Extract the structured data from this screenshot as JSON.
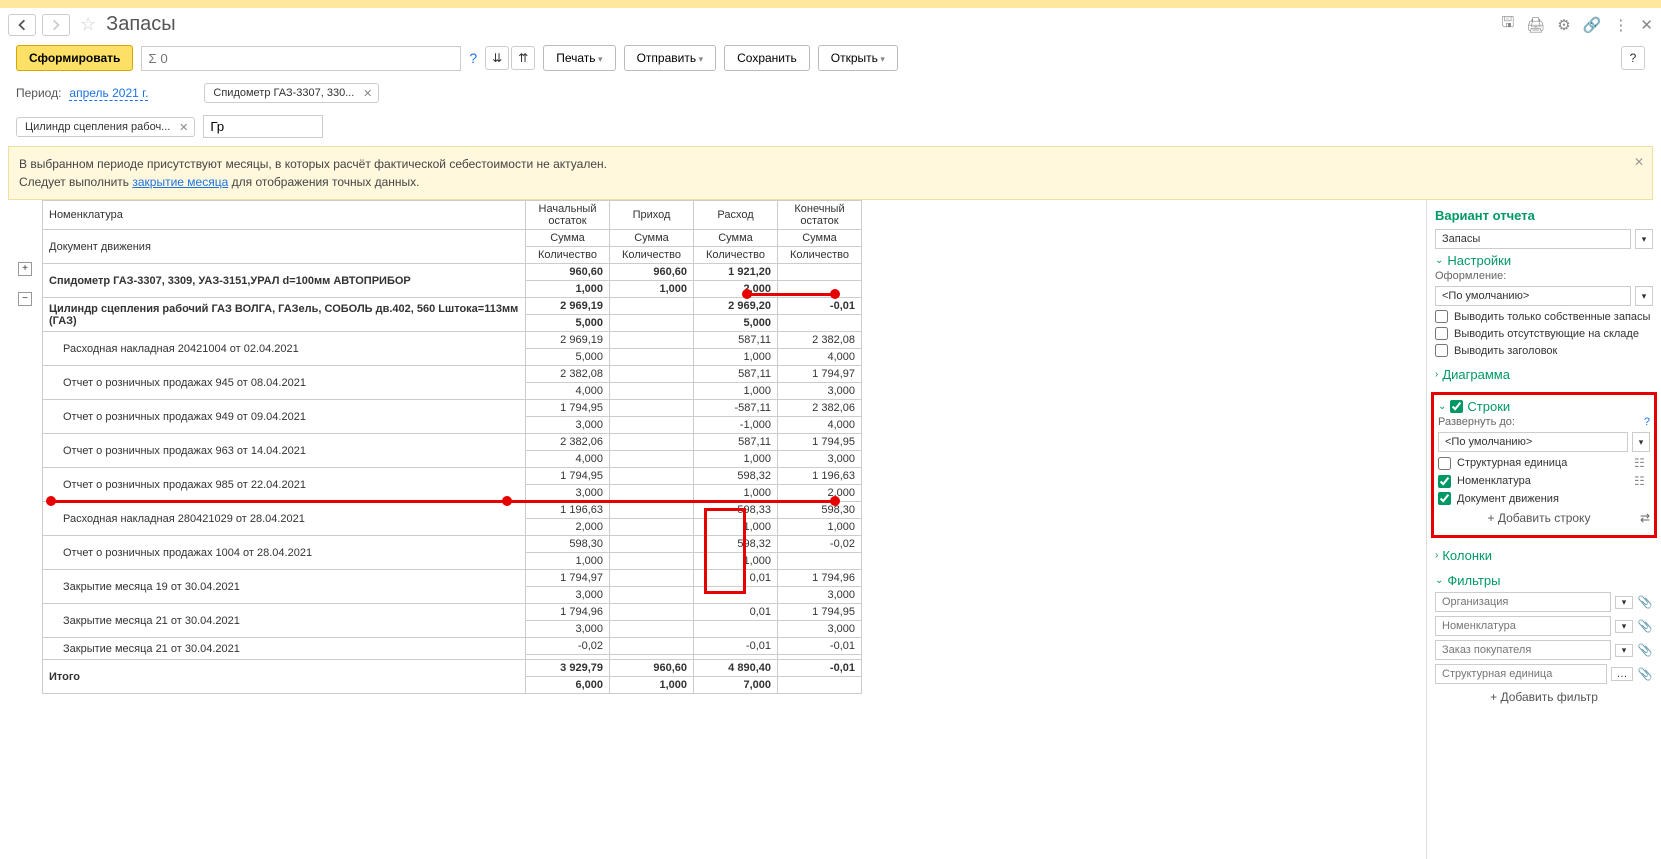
{
  "header": {
    "title": "Запасы"
  },
  "toolbar": {
    "generate": "Сформировать",
    "sigma_placeholder": "Σ 0",
    "print": "Печать",
    "send": "Отправить",
    "save": "Сохранить",
    "open": "Открыть"
  },
  "chips": {
    "period_label": "Период:",
    "period_value": "апрель 2021 г.",
    "chip1": "Спидометр ГАЗ-3307, 330...",
    "chip2": "Цилиндр сцепления рабоч...",
    "input2": "Гр"
  },
  "warn": {
    "line1": "В выбранном периоде присутствуют месяцы, в которых расчёт фактической себестоимости не актуален.",
    "line2a": "Следует выполнить ",
    "link": "закрытие месяца",
    "line2b": " для отображения точных данных."
  },
  "table": {
    "h_nomen": "Номенклатура",
    "h_doc": "Документ движения",
    "h_begin": "Начальный остаток",
    "h_in": "Приход",
    "h_out": "Расход",
    "h_end": "Конечный остаток",
    "h_sum": "Сумма",
    "h_qty": "Количество",
    "rows": [
      {
        "name": "Спидометр ГАЗ-3307, 3309, УАЗ-3151,УРАЛ d=100мм АВТОПРИБОР",
        "b_s": "960,60",
        "b_q": "1,000",
        "i_s": "960,60",
        "i_q": "1,000",
        "o_s": "1 921,20",
        "o_q": "2,000",
        "e_s": "",
        "e_q": "",
        "lvl": 0
      },
      {
        "name": "Цилиндр сцепления рабочий ГАЗ ВОЛГА, ГАЗель, СОБОЛЬ дв.402, 560 Lштока=113мм (ГАЗ)",
        "b_s": "2 969,19",
        "b_q": "5,000",
        "i_s": "",
        "i_q": "",
        "o_s": "2 969,20",
        "o_q": "5,000",
        "e_s": "-0,01",
        "e_q": "",
        "lvl": 0
      },
      {
        "name": "Расходная накладная 20421004 от 02.04.2021",
        "b_s": "2 969,19",
        "b_q": "5,000",
        "i_s": "",
        "i_q": "",
        "o_s": "587,11",
        "o_q": "1,000",
        "e_s": "2 382,08",
        "e_q": "4,000",
        "lvl": 1
      },
      {
        "name": "Отчет о розничных продажах 945 от 08.04.2021",
        "b_s": "2 382,08",
        "b_q": "4,000",
        "i_s": "",
        "i_q": "",
        "o_s": "587,11",
        "o_q": "1,000",
        "e_s": "1 794,97",
        "e_q": "3,000",
        "lvl": 1
      },
      {
        "name": "Отчет о розничных продажах 949 от 09.04.2021",
        "b_s": "1 794,95",
        "b_q": "3,000",
        "i_s": "",
        "i_q": "",
        "o_s": "-587,11",
        "o_q": "-1,000",
        "e_s": "2 382,06",
        "e_q": "4,000",
        "lvl": 1
      },
      {
        "name": "Отчет о розничных продажах 963 от 14.04.2021",
        "b_s": "2 382,06",
        "b_q": "4,000",
        "i_s": "",
        "i_q": "",
        "o_s": "587,11",
        "o_q": "1,000",
        "e_s": "1 794,95",
        "e_q": "3,000",
        "lvl": 1
      },
      {
        "name": "Отчет о розничных продажах 985 от 22.04.2021",
        "b_s": "1 794,95",
        "b_q": "3,000",
        "i_s": "",
        "i_q": "",
        "o_s": "598,32",
        "o_q": "1,000",
        "e_s": "1 196,63",
        "e_q": "2,000",
        "lvl": 1
      },
      {
        "name": "Расходная накладная 280421029 от 28.04.2021",
        "b_s": "1 196,63",
        "b_q": "2,000",
        "i_s": "",
        "i_q": "",
        "o_s": "598,33",
        "o_q": "1,000",
        "e_s": "598,30",
        "e_q": "1,000",
        "lvl": 1
      },
      {
        "name": "Отчет о розничных продажах 1004 от 28.04.2021",
        "b_s": "598,30",
        "b_q": "1,000",
        "i_s": "",
        "i_q": "",
        "o_s": "598,32",
        "o_q": "1,000",
        "e_s": "-0,02",
        "e_q": "",
        "lvl": 1
      },
      {
        "name": "Закрытие месяца 19 от 30.04.2021",
        "b_s": "1 794,97",
        "b_q": "3,000",
        "i_s": "",
        "i_q": "",
        "o_s": "0,01",
        "o_q": "",
        "e_s": "1 794,96",
        "e_q": "3,000",
        "lvl": 1
      },
      {
        "name": "Закрытие месяца 21 от 30.04.2021",
        "b_s": "1 794,96",
        "b_q": "3,000",
        "i_s": "",
        "i_q": "",
        "o_s": "0,01",
        "o_q": "",
        "e_s": "1 794,95",
        "e_q": "3,000",
        "lvl": 1
      },
      {
        "name": "Закрытие месяца 21 от 30.04.2021",
        "b_s": "-0,02",
        "b_q": "",
        "i_s": "",
        "i_q": "",
        "o_s": "-0,01",
        "o_q": "",
        "e_s": "-0,01",
        "e_q": "",
        "lvl": 1
      }
    ],
    "total_label": "Итого",
    "total": {
      "b_s": "3 929,79",
      "b_q": "6,000",
      "i_s": "960,60",
      "i_q": "1,000",
      "o_s": "4 890,40",
      "o_q": "7,000",
      "e_s": "-0,01",
      "e_q": ""
    }
  },
  "sidebar": {
    "variant_title": "Вариант отчета",
    "variant_value": "Запасы",
    "settings": "Настройки",
    "formatting_label": "Оформление:",
    "formatting_value": "<По умолчанию>",
    "chk_own": "Выводить только собственные запасы",
    "chk_absent": "Выводить отсутствующие на складе",
    "chk_header": "Выводить заголовок",
    "diagram": "Диаграмма",
    "rows": "Строки",
    "expand_to": "Развернуть до:",
    "expand_value": "<По умолчанию>",
    "chk_struct": "Структурная единица",
    "chk_nomen": "Номенклатура",
    "chk_doc": "Документ движения",
    "add_row": "+ Добавить строку",
    "columns": "Колонки",
    "filters": "Фильтры",
    "f_org": "Организация",
    "f_nomen": "Номенклатура",
    "f_order": "Заказ покупателя",
    "f_struct": "Структурная единица",
    "add_filter": "+ Добавить фильтр"
  }
}
